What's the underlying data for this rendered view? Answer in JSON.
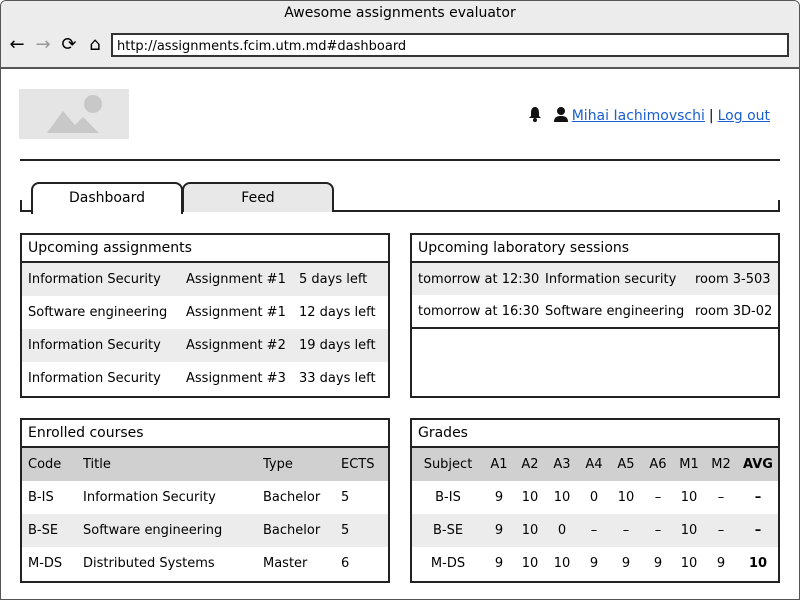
{
  "window": {
    "title": "Awesome assignments evaluator"
  },
  "browser": {
    "url": "http://assignments.fcim.utm.md#dashboard"
  },
  "user": {
    "name": "Mihai Iachimovschi",
    "separator": "|",
    "logout": "Log out"
  },
  "tabs": [
    {
      "label": "Dashboard"
    },
    {
      "label": "Feed"
    }
  ],
  "upcoming_assignments": {
    "title": "Upcoming assignments",
    "rows": [
      {
        "subject": "Information Security",
        "assignment": "Assignment #1",
        "due": "5 days left"
      },
      {
        "subject": "Software engineering",
        "assignment": "Assignment #1",
        "due": "12 days left"
      },
      {
        "subject": "Information Security",
        "assignment": "Assignment #2",
        "due": "19 days left"
      },
      {
        "subject": "Information Security",
        "assignment": "Assignment #3",
        "due": "33 days left"
      }
    ]
  },
  "lab_sessions": {
    "title": "Upcoming laboratory sessions",
    "rows": [
      {
        "when": "tomorrow at 12:30",
        "subject": "Information security",
        "room": "room 3-503"
      },
      {
        "when": "tomorrow at 16:30",
        "subject": "Software engineering",
        "room": "room 3D-02"
      }
    ]
  },
  "enrolled_courses": {
    "title": "Enrolled courses",
    "headers": {
      "code": "Code",
      "title": "Title",
      "type": "Type",
      "ects": "ECTS"
    },
    "rows": [
      {
        "code": "B-IS",
        "title": "Information Security",
        "type": "Bachelor",
        "ects": "5"
      },
      {
        "code": "B-SE",
        "title": "Software engineering",
        "type": "Bachelor",
        "ects": "5"
      },
      {
        "code": "M-DS",
        "title": "Distributed Systems",
        "type": "Master",
        "ects": "6"
      }
    ]
  },
  "grades": {
    "title": "Grades",
    "headers": [
      "Subject",
      "A1",
      "A2",
      "A3",
      "A4",
      "A5",
      "A6",
      "M1",
      "M2",
      "AVG"
    ],
    "rows": [
      [
        "B-IS",
        "9",
        "10",
        "10",
        "0",
        "10",
        "–",
        "10",
        "–",
        "–"
      ],
      [
        "B-SE",
        "9",
        "10",
        "0",
        "–",
        "–",
        "–",
        "10",
        "–",
        "–"
      ],
      [
        "M-DS",
        "9",
        "10",
        "10",
        "9",
        "9",
        "9",
        "10",
        "9",
        "10"
      ]
    ]
  }
}
